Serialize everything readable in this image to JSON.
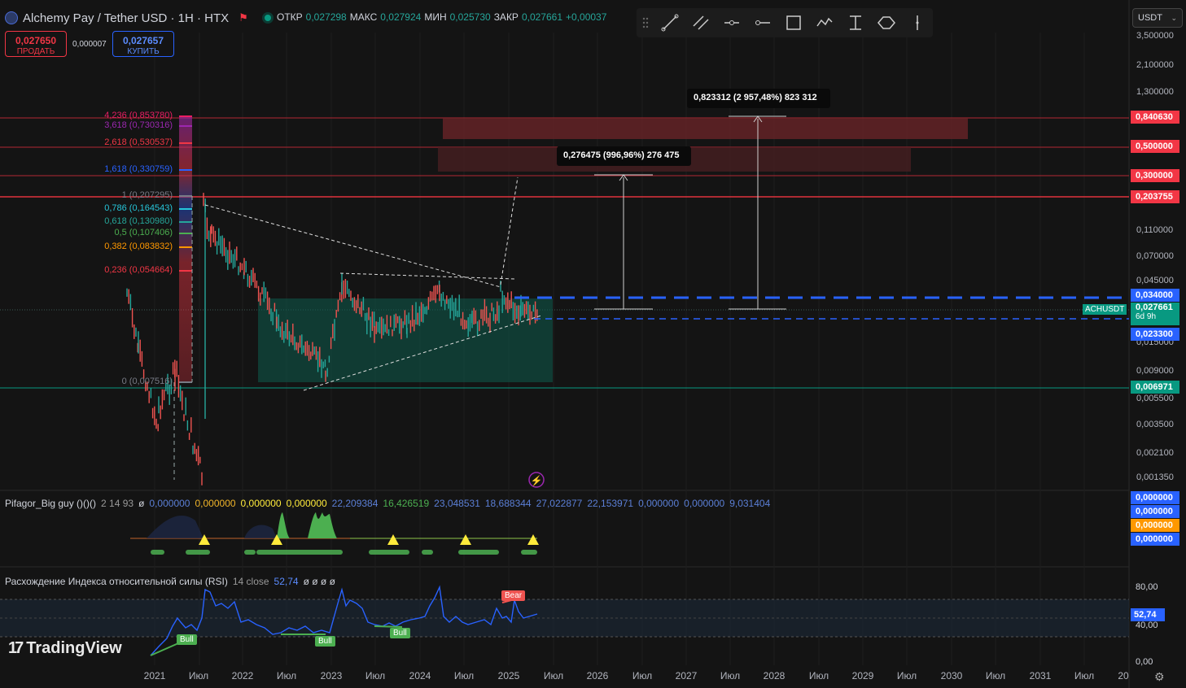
{
  "header": {
    "symbol_title": "Alchemy Pay / Tether USD · 1H · HTX",
    "ohlc": [
      {
        "k": "ОТКР",
        "v": "0,027298"
      },
      {
        "k": "МАКС",
        "v": "0,027924"
      },
      {
        "k": "МИН",
        "v": "0,025730"
      },
      {
        "k": "ЗАКР",
        "v": "0,027661"
      },
      {
        "k": "",
        "v": "+0,00037"
      }
    ]
  },
  "trade": {
    "sell_price": "0,027650",
    "sell_label": "ПРОДАТЬ",
    "spread": "0,000007",
    "buy_price": "0,027657",
    "buy_label": "КУПИТЬ"
  },
  "currency_select": {
    "value": "USDT",
    "icon": "chevron-down-icon"
  },
  "toolbar_icons": [
    "drag-handle-icon",
    "trend-line-icon",
    "parallel-channel-icon",
    "horizontal-ray-icon",
    "horizontal-line-icon",
    "rectangle-icon",
    "path-icon",
    "price-range-icon",
    "ellipse-icon",
    "vertical-line-icon"
  ],
  "price_axis": [
    "3,500000",
    "2,100000",
    "1,300000",
    "0,110000",
    "0,070000",
    "0,045000",
    "0,015000",
    "0,009000",
    "0,005500",
    "0,003500",
    "0,002100",
    "0,001350"
  ],
  "price_tags": [
    {
      "v": "0,840630",
      "bg": "#f23645"
    },
    {
      "v": "0,500000",
      "bg": "#f23645"
    },
    {
      "v": "0,300000",
      "bg": "#f23645"
    },
    {
      "v": "0,203755",
      "bg": "#f23645"
    },
    {
      "v": "0,034000",
      "bg": "#2962ff"
    },
    {
      "v": "0,023300",
      "bg": "#2962ff"
    },
    {
      "v": "0,006971",
      "bg": "#089981"
    }
  ],
  "last_price": {
    "ticker": "ACHUSDT",
    "price": "0,027661",
    "countdown": "6d 9h",
    "bg": "#089981"
  },
  "fib_levels": [
    {
      "label": "4,236 (0,853780)",
      "color": "#e91e63"
    },
    {
      "label": "3,618 (0,730316)",
      "color": "#9c27b0"
    },
    {
      "label": "2,618 (0,530537)",
      "color": "#f23645"
    },
    {
      "label": "1,618 (0,330759)",
      "color": "#2962ff"
    },
    {
      "label": "1 (0,207295)",
      "color": "#787b86"
    },
    {
      "label": "0,786 (0,164543)",
      "color": "#26c6da"
    },
    {
      "label": "0,618 (0,130980)",
      "color": "#26a69a"
    },
    {
      "label": "0,5 (0,107406)",
      "color": "#4caf50"
    },
    {
      "label": "0,382 (0,083832)",
      "color": "#ff9800"
    },
    {
      "label": "0,236 (0,054664)",
      "color": "#f23645"
    },
    {
      "label": "0 (0,007516)",
      "color": "#787b86"
    }
  ],
  "measure_labels": [
    "0,823312 (2 957,48%) 823 312",
    "0,276475 (996,96%) 276 475"
  ],
  "pifagor": {
    "name": "Pifagor_Big guy ()()()",
    "params": "2 14 93",
    "symbol": "ø",
    "values": [
      {
        "v": "0,000000",
        "c": "#5b7fd6"
      },
      {
        "v": "0,000000",
        "c": "#f0b429"
      },
      {
        "v": "0,000000",
        "c": "#ffeb3b"
      },
      {
        "v": "0,000000",
        "c": "#ffeb3b"
      },
      {
        "v": "22,209384",
        "c": "#5b7fd6"
      },
      {
        "v": "16,426519",
        "c": "#4caf50"
      },
      {
        "v": "23,048531",
        "c": "#5b7fd6"
      },
      {
        "v": "18,688344",
        "c": "#5b7fd6"
      },
      {
        "v": "27,022877",
        "c": "#5b7fd6"
      },
      {
        "v": "22,153971",
        "c": "#5b7fd6"
      },
      {
        "v": "0,000000",
        "c": "#5b7fd6"
      },
      {
        "v": "0,000000",
        "c": "#5b7fd6"
      },
      {
        "v": "9,031404",
        "c": "#5b7fd6"
      }
    ],
    "tags": [
      {
        "v": "0,000000",
        "bg": "#2962ff"
      },
      {
        "v": "0,000000",
        "bg": "#2962ff"
      },
      {
        "v": "0,000000",
        "bg": "#ff9800"
      },
      {
        "v": "0,000000",
        "bg": "#2962ff"
      }
    ]
  },
  "rsi": {
    "name": "Расхождение Индекса относительной силы (RSI)",
    "params": "14 close",
    "value": "52,74",
    "extra": "ø ø ø ø",
    "axis": [
      "80,00",
      "40,00",
      "0,00"
    ],
    "tag": "52,74",
    "labels": [
      "Bull",
      "Bull",
      "Bull",
      "Bear"
    ]
  },
  "time_axis": [
    "2021",
    "Июл",
    "2022",
    "Июл",
    "2023",
    "Июл",
    "2024",
    "Июл",
    "2025",
    "Июл",
    "2026",
    "Июл",
    "2027",
    "Июл",
    "2028",
    "Июл",
    "2029",
    "Июл",
    "2030",
    "Июл",
    "2031",
    "Июл",
    "20"
  ],
  "branding": "TradingView",
  "colors": {
    "up": "#26a69a",
    "down": "#ef5350",
    "accent": "#2962ff",
    "bg": "#141414"
  }
}
